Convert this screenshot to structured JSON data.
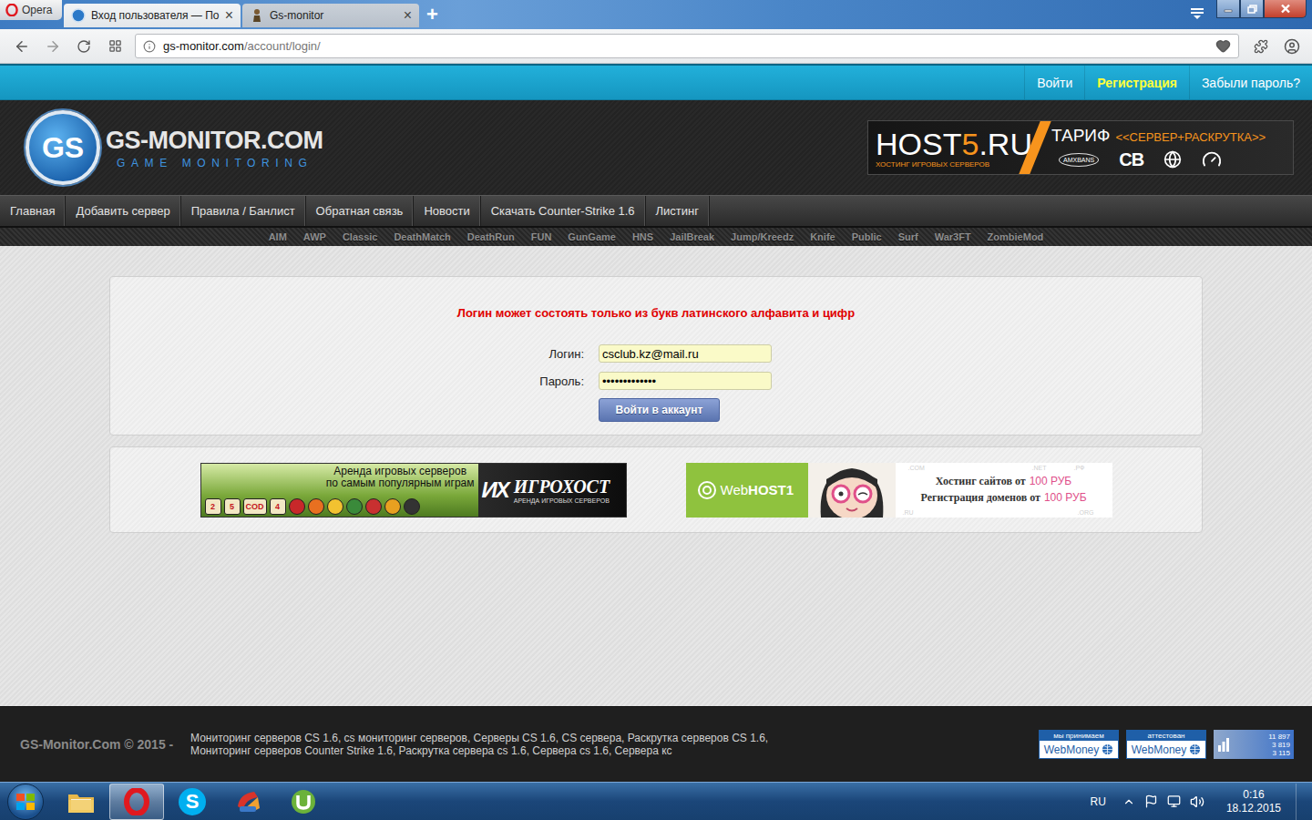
{
  "browser": {
    "menu_button": "Opera",
    "tabs": [
      {
        "label": "Вход пользователя — По",
        "selected": true,
        "close": "×",
        "kind": "gs"
      },
      {
        "label": "Gs-monitor",
        "selected": false,
        "close": "×",
        "kind": "soldier"
      }
    ],
    "new_tab": "+",
    "address": {
      "host": "gs-monitor.com",
      "path": "/account/login/",
      "bookmarked": false
    }
  },
  "top_links": [
    {
      "label": "Войти",
      "highlighted": false
    },
    {
      "label": "Регистрация",
      "highlighted": true
    },
    {
      "label": "Забыли пароль?",
      "highlighted": false
    }
  ],
  "site_header": {
    "logo": {
      "badge": "GS",
      "title": "GS-MONITOR.COM",
      "subtitle": "GAME MONITORING"
    },
    "ad": {
      "brand": [
        "HOST",
        "5",
        ".RU"
      ],
      "tagline": "ХОСТИНГ ИГРОВЫХ СЕРВЕРОВ",
      "tariff": "ТАРИФ",
      "offer": "<<СЕРВЕР+РАСКРУТКА>>",
      "partners": [
        "AMXBANS",
        "CB"
      ]
    }
  },
  "main_menu": [
    "Главная",
    "Добавить сервер",
    "Правила / Банлист",
    "Обратная связь",
    "Новости",
    "Скачать Counter-Strike 1.6",
    "Листинг"
  ],
  "mode_menu": [
    "AIM",
    "AWP",
    "Classic",
    "DeathMatch",
    "DeathRun",
    "FUN",
    "GunGame",
    "HNS",
    "JailBreak",
    "Jump/Kreedz",
    "Knife",
    "Public",
    "Surf",
    "War3FT",
    "ZombieMod"
  ],
  "login": {
    "error": "Логин может состоять только из букв латинского алфавита и цифр",
    "fields": [
      {
        "label": "Логин:",
        "value": "csclub.kz@mail.ru",
        "kind": "text"
      },
      {
        "label": "Пароль:",
        "value": "•••••••••••••",
        "kind": "password"
      }
    ],
    "submit": "Войти в аккаунт"
  },
  "ads": {
    "igrohost": {
      "caption": [
        "Аренда игровых серверов",
        "по самым популярным играм"
      ],
      "game_marks": [
        "2",
        "5",
        "COD",
        "4"
      ],
      "mark": "ИХ",
      "name": "ИГРОХОСТ",
      "tagline": "АРЕНДА ИГРОВЫХ СЕРВЕРОВ"
    },
    "webhost": {
      "brand": [
        "Web",
        "HOST1"
      ],
      "lines": [
        {
          "text": "Хостинг сайтов от",
          "price": "100 РУБ"
        },
        {
          "text": "Регистрация доменов от",
          "price": "100 РУБ"
        }
      ],
      "zones": [
        ".COM",
        ".NET",
        ".РФ",
        ".RU",
        ".ORG"
      ]
    }
  },
  "footer": {
    "copyright": "GS-Monitor.Com © 2015 -",
    "lines": [
      "Мониторинг серверов CS 1.6, cs мониторинг серверов, Серверы CS 1.6, CS сервера, Раскрутка серверов CS 1.6,",
      "Мониторинг серверов Counter Strike 1.6, Раскрутка сервера cs 1.6, Сервера cs 1.6, Сервера кс"
    ],
    "badges": [
      {
        "caption": "мы принимаем",
        "name": "WebMoney"
      },
      {
        "caption": "аттестован",
        "name": "WebMoney"
      }
    ],
    "counter": [
      "11 897",
      "3 819",
      "3 115"
    ]
  },
  "taskbar": {
    "apps": [
      {
        "kind": "explorer",
        "active": false,
        "glyph": ""
      },
      {
        "kind": "opera",
        "active": true,
        "glyph": ""
      },
      {
        "kind": "skype",
        "active": false,
        "glyph": "S"
      },
      {
        "kind": "ccleaner",
        "active": false,
        "glyph": ""
      },
      {
        "kind": "utorrent",
        "active": false,
        "glyph": ""
      }
    ],
    "language": "RU",
    "clock": {
      "time": "0:16",
      "date": "18.12.2015"
    }
  }
}
